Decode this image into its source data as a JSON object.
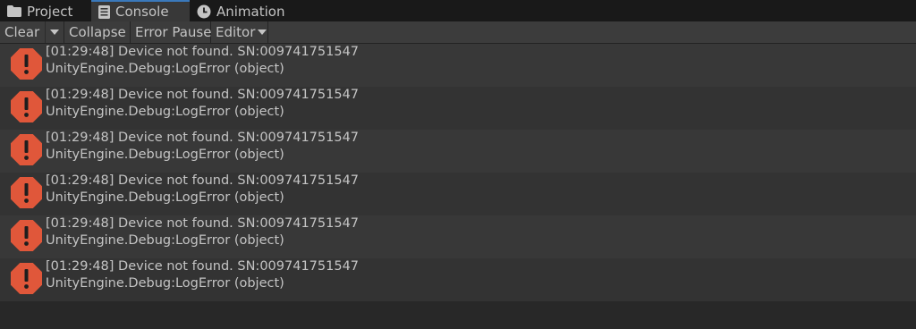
{
  "tabs": [
    {
      "label": "Project",
      "icon": "folder-icon"
    },
    {
      "label": "Console",
      "icon": "console-icon",
      "active": true
    },
    {
      "label": "Animation",
      "icon": "clock-icon"
    }
  ],
  "toolbar": {
    "clear_label": "Clear",
    "collapse_label": "Collapse",
    "error_pause_label": "Error Pause",
    "editor_label": "Editor"
  },
  "log": [
    {
      "line1": "[01:29:48] Device not found. SN:009741751547",
      "line2": "UnityEngine.Debug:LogError (object)",
      "type": "error"
    },
    {
      "line1": "[01:29:48] Device not found. SN:009741751547",
      "line2": "UnityEngine.Debug:LogError (object)",
      "type": "error"
    },
    {
      "line1": "[01:29:48] Device not found. SN:009741751547",
      "line2": "UnityEngine.Debug:LogError (object)",
      "type": "error"
    },
    {
      "line1": "[01:29:48] Device not found. SN:009741751547",
      "line2": "UnityEngine.Debug:LogError (object)",
      "type": "error"
    },
    {
      "line1": "[01:29:48] Device not found. SN:009741751547",
      "line2": "UnityEngine.Debug:LogError (object)",
      "type": "error"
    },
    {
      "line1": "[01:29:48] Device not found. SN:009741751547",
      "line2": "UnityEngine.Debug:LogError (object)",
      "type": "error"
    }
  ],
  "colors": {
    "error_icon": "#e0573a",
    "active_tab_accent": "#3a79bb"
  }
}
